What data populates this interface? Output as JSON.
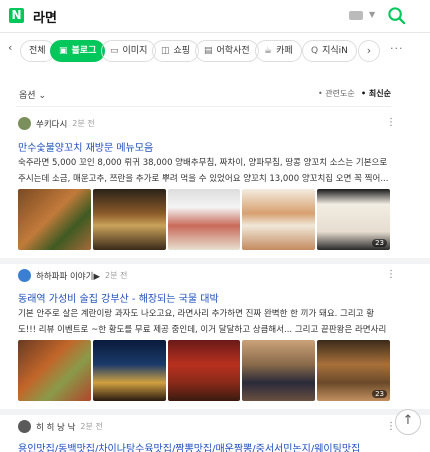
{
  "header": {
    "logo": "N",
    "query": "라면",
    "keyboard_icon": "keyboard-icon",
    "search_icon": "search-icon"
  },
  "tabs": {
    "items": [
      {
        "label": "전체",
        "icon": "filter-icon"
      },
      {
        "label": "블로그",
        "icon": "blog-icon",
        "active": true
      },
      {
        "label": "이미지",
        "icon": "image-icon"
      },
      {
        "label": "쇼핑",
        "icon": "shopping-icon"
      },
      {
        "label": "어학사전",
        "icon": "dictionary-icon"
      },
      {
        "label": "카페",
        "icon": "cafe-icon"
      },
      {
        "label": "지식iN",
        "icon": "q-icon"
      }
    ]
  },
  "options": {
    "label": "옵션",
    "sort_relevance": "관련도순",
    "sort_latest": "최신순"
  },
  "posts": [
    {
      "author": "쑤키다시",
      "time": "2분 전",
      "title": "만수숯불양꼬치 재방문 메뉴모음",
      "desc": "숙주라면 5,000 꼬인 8,000 뤼귀 38,000 양배추무침, 짜차이, 양파무침, 땅콩 양꼬치 소스는 기본으로 주시는데 소금, 매운고추, 쯔란을 추가로 뿌려 먹을 수 있었어요 양꼬치 13,000 양꼬치집 오면 꼭 찍어...",
      "img_count": "23"
    },
    {
      "author": "하하파파 이야기▶",
      "time": "2분 전",
      "title": "동래역 가성비 술집 강부산 - 해장되는 국물 대박",
      "desc": "기본 안주로 살은 계란이랑 과자도 나오고요, 라면사리 추가하면 진짜 완벽한 한 끼가 돼요. 그리고 황도!!! 리뷰 이벤트로 ~한 황도를 무료 제공 중인데, 이거 달달하고 상큼해서... 그리고 끝판왕은 라면사리 ...",
      "img_count": "23"
    },
    {
      "author": "히 히 낭 낙",
      "time": "2분 전",
      "title": "용인맛집/동백맛집/차이나탕수육맛집/짬뽕맛집/매운짬뽕/중서서민논지/웨이팅맛집"
    }
  ]
}
